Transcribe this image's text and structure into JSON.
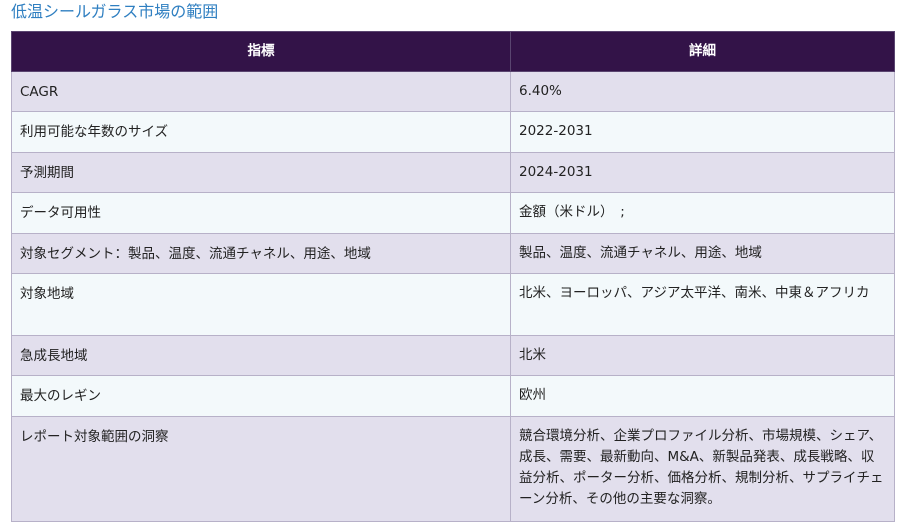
{
  "title": "低温シールガラス市場の範囲",
  "table": {
    "headers": [
      "指標",
      "詳細"
    ],
    "rows": [
      {
        "label": "CAGR",
        "value": "6.40%"
      },
      {
        "label": "利用可能な年数のサイズ",
        "value": "2022-2031"
      },
      {
        "label": "予測期間",
        "value": "2024-2031"
      },
      {
        "label": "データ可用性",
        "value": "金額（米ドル）　;"
      },
      {
        "label": "対象セグメント：製品、温度、流通チャネル、用途、地域",
        "value": "製品、温度、流通チャネル、用途、地域"
      },
      {
        "label": "対象地域",
        "value": "北米、ヨーロッパ、アジア太平洋、南米、中東＆アフリカ"
      },
      {
        "label": "急成長地域",
        "value": "北米"
      },
      {
        "label": "最大のレギン",
        "value": "欧州"
      },
      {
        "label": "レポート対象範囲の洞察",
        "value": "競合環境分析、企業プロファイル分析、市場規模、シェア、成長、需要、最新動向、M&A、新製品発表、成長戦略、収益分析、ポーター分析、価格分析、規制分析、サプライチェーン分析、その他の主要な洞察。"
      }
    ]
  }
}
